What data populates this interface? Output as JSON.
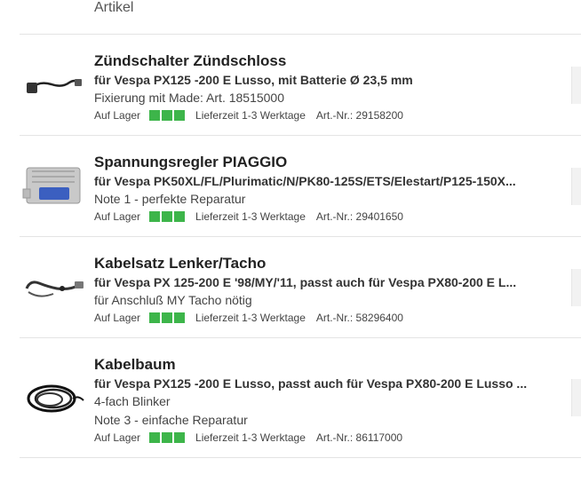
{
  "column_header": "Artikel",
  "colors": {
    "stock_green": "#3db54a",
    "divider": "#e4e4e4"
  },
  "products": [
    {
      "title": "Zündschalter Zündschloss",
      "subtitle": "für Vespa PX125 -200 E Lusso, mit Batterie Ø 23,5 mm",
      "notes": [
        "Fixierung mit Made: Art. 18515000"
      ],
      "stock": "Auf Lager",
      "delivery": "Lieferzeit 1-3 Werktage",
      "article": "Art.-Nr.: 29158200",
      "icon": "ignition-switch-icon"
    },
    {
      "title": "Spannungsregler PIAGGIO",
      "subtitle": "für Vespa PK50XL/FL/Plurimatic/N/PK80-125S/ETS/Elestart/P125-150X...",
      "notes": [
        "Note 1 - perfekte Reparatur"
      ],
      "stock": "Auf Lager",
      "delivery": "Lieferzeit 1-3 Werktage",
      "article": "Art.-Nr.: 29401650",
      "icon": "voltage-regulator-icon"
    },
    {
      "title": "Kabelsatz Lenker/Tacho",
      "subtitle": "für Vespa PX 125-200 E '98/MY/'11, passt auch für Vespa PX80-200 E L...",
      "notes": [
        "für Anschluß MY Tacho nötig"
      ],
      "stock": "Auf Lager",
      "delivery": "Lieferzeit 1-3 Werktage",
      "article": "Art.-Nr.: 58296400",
      "icon": "cable-set-icon"
    },
    {
      "title": "Kabelbaum",
      "subtitle": "für Vespa PX125 -200 E Lusso, passt auch für Vespa PX80-200 E Lusso ...",
      "notes": [
        "4-fach Blinker",
        "Note 3 - einfache Reparatur"
      ],
      "stock": "Auf Lager",
      "delivery": "Lieferzeit 1-3 Werktage",
      "article": "Art.-Nr.: 86117000",
      "icon": "wiring-harness-icon"
    }
  ]
}
